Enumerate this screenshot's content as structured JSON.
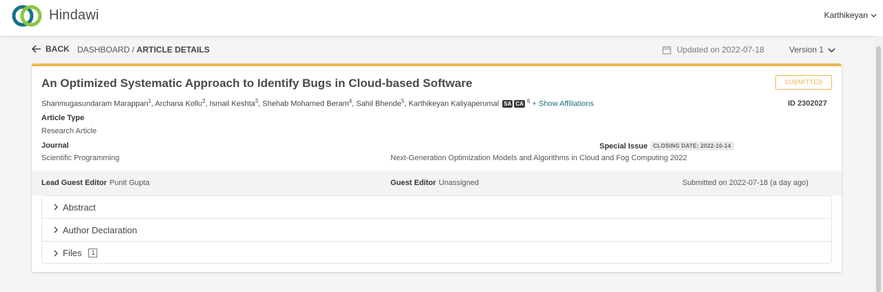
{
  "app": {
    "brand": "Hindawi",
    "user": "Karthikeyan",
    "colors": {
      "accent": "#f0b650",
      "link": "#1e6c7a",
      "logo_green": "#8cc63f",
      "logo_teal": "#16728a"
    }
  },
  "nav": {
    "back_label": "BACK",
    "breadcrumb_parent": "DASHBOARD",
    "breadcrumb_sep": "/",
    "breadcrumb_current": "ARTICLE DETAILS",
    "updated": "Updated on 2022-07-18",
    "version": "Version 1"
  },
  "article": {
    "title": "An Optimized Systematic Approach to Identify Bugs in Cloud-based Software",
    "status": "SUBMITTED",
    "id_label": "ID 2302027",
    "authors": [
      {
        "name": "Shanmugasundaram Marappan",
        "sup": "1"
      },
      {
        "name": "Archana Kollu",
        "sup": "2"
      },
      {
        "name": "Ismail Keshta",
        "sup": "3"
      },
      {
        "name": "Shehab Mohamed Beram",
        "sup": "4"
      },
      {
        "name": "Sahil Bhende",
        "sup": "5"
      },
      {
        "name": "Karthikeyan Kaliyaperumal",
        "sup": "6"
      }
    ],
    "author_tags": [
      "SA",
      "CA"
    ],
    "show_affiliations": "+ Show Affiliations",
    "article_type_label": "Article Type",
    "article_type": "Research Article",
    "journal_label": "Journal",
    "journal": "Scientific Programming",
    "special_issue_label": "Special Issue",
    "closing_date": "CLOSING DATE: 2022-10-14",
    "special_issue": "Next-Generation Optimization Models and Algorithms in Cloud and Fog Computing 2022"
  },
  "editors": {
    "lead_label": "Lead Guest Editor",
    "lead_value": "Punit Gupta",
    "guest_label": "Guest Editor",
    "guest_value": "Unassigned",
    "submitted": "Submitted on 2022-07-18 (a day ago)"
  },
  "accordion": [
    {
      "label": "Abstract"
    },
    {
      "label": "Author Declaration"
    },
    {
      "label": "Files",
      "count": "1"
    }
  ]
}
